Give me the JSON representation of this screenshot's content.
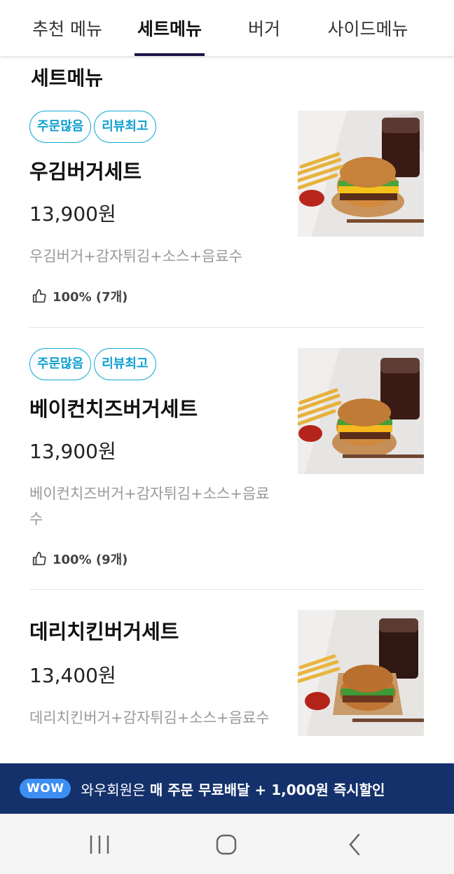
{
  "tabs": [
    {
      "label": "추천 메뉴",
      "active": false
    },
    {
      "label": "세트메뉴",
      "active": true
    },
    {
      "label": "버거",
      "active": false
    },
    {
      "label": "사이드메뉴",
      "active": false
    }
  ],
  "section_title": "세트메뉴",
  "items": [
    {
      "badges": [
        "주문많음",
        "리뷰최고"
      ],
      "name": "우김버거세트",
      "price": "13,900원",
      "desc": "우김버거+감자튀김+소스+음료수",
      "rating": "100% (7개)"
    },
    {
      "badges": [
        "주문많음",
        "리뷰최고"
      ],
      "name": "베이컨치즈버거세트",
      "price": "13,900원",
      "desc": "베이컨치즈버거+감자튀김+소스+음료수",
      "rating": "100% (9개)"
    },
    {
      "badges": [],
      "name": "데리치킨버거세트",
      "price": "13,400원",
      "desc": "데리치킨버거+감자튀김+소스+음료수"
    }
  ],
  "promo": {
    "pill": "WOW",
    "text_plain": "와우회원은",
    "text_bold": "매 주문 무료배달 + 1,000원 즉시할인"
  },
  "icons": {
    "like": "thumbs-up-icon",
    "recent": "recent-apps-icon",
    "home": "home-icon",
    "back": "back-icon"
  },
  "colors": {
    "accent_badge": "#15a8d6",
    "active_tab_underline": "#1a1746",
    "promo_bg": "#14316b",
    "promo_pill": "#3d8ef2"
  }
}
